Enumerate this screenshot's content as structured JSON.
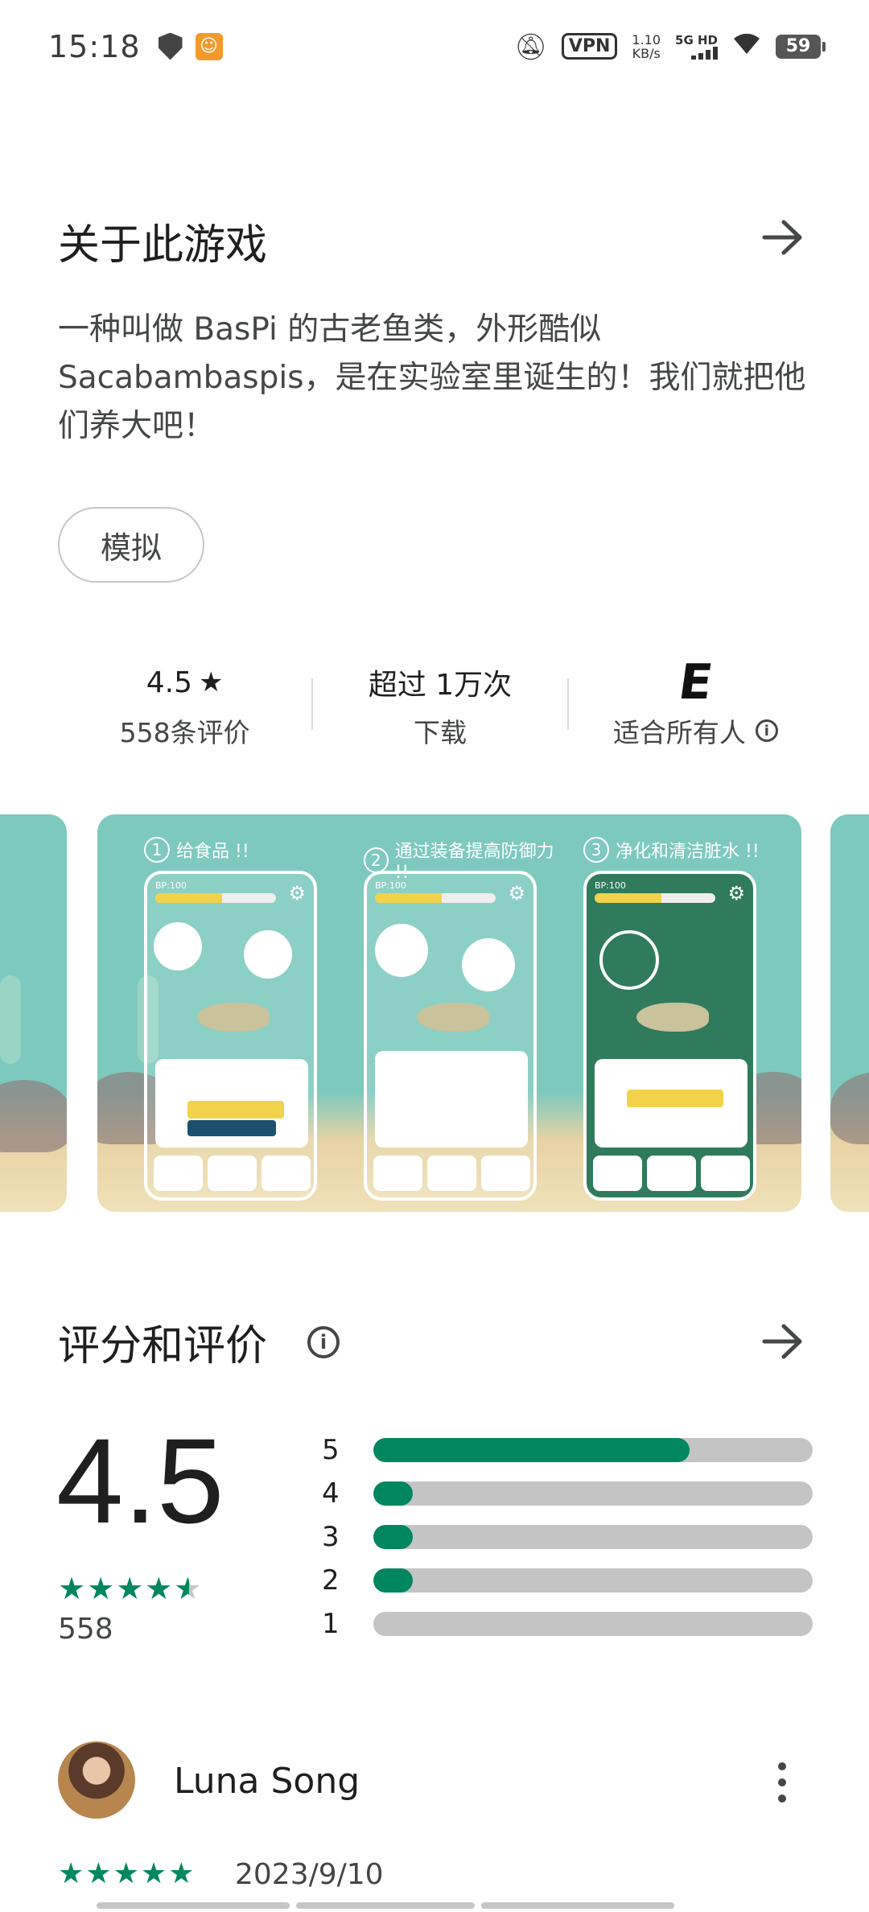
{
  "status_bar": {
    "time": "15:18",
    "vpn": "VPN",
    "net_speed_value": "1.10",
    "net_speed_unit": "KB/s",
    "network": "5G HD",
    "battery": "59"
  },
  "about": {
    "title": "关于此游戏",
    "description": "一种叫做 BasPi 的古老鱼类，外形酷似 Sacabambaspis，是在实验室里诞生的！我们就把他们养大吧！",
    "tag": "模拟"
  },
  "stats": {
    "rating_value": "4.5",
    "rating_star": "★",
    "reviews_label": "558条评价",
    "downloads_value": "超过 1万次",
    "downloads_label": "下载",
    "content_rating_icon": "E",
    "content_rating_label": "适合所有人"
  },
  "screenshots": {
    "panels": [
      {
        "num": "1",
        "caption": "给食品 !!"
      },
      {
        "num": "2",
        "caption": "通过装备提高防御力 !!"
      },
      {
        "num": "3",
        "caption": "净化和清洁脏水 !!"
      }
    ]
  },
  "ratings": {
    "title": "评分和评价",
    "score": "4.5",
    "count": "558",
    "distribution": [
      {
        "label": "5",
        "fraction": 0.72
      },
      {
        "label": "4",
        "fraction": 0.09
      },
      {
        "label": "3",
        "fraction": 0.09
      },
      {
        "label": "2",
        "fraction": 0.09
      },
      {
        "label": "1",
        "fraction": 0.0
      }
    ],
    "average_stars": 4.5
  },
  "review": {
    "author": "Luna Song",
    "stars": 5,
    "date": "2023/9/10"
  },
  "colors": {
    "accent_green": "#01875f",
    "track_gray": "#c4c4c4",
    "screenshot_teal": "#7dc9be"
  },
  "icons": {
    "arrow": "arrow-right-icon",
    "info": "info-icon",
    "more": "more-vert-icon"
  }
}
